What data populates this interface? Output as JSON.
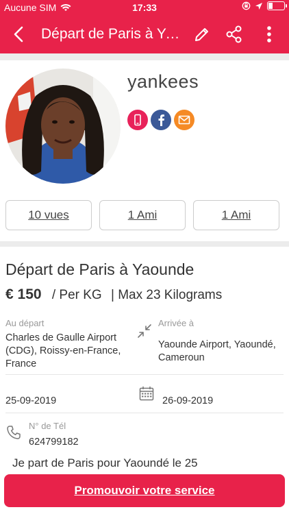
{
  "status_bar": {
    "carrier": "Aucune SIM",
    "time": "17:33"
  },
  "app_bar": {
    "title": "Départ de Paris à Yaounde"
  },
  "profile": {
    "username": "yankees",
    "social_icons": [
      "phone-icon",
      "facebook-icon",
      "email-icon"
    ],
    "social_colors": {
      "phone": "#e8225a",
      "facebook": "#3b5998",
      "email": "#f58a25"
    },
    "stats": [
      "10 vues",
      "1 Ami",
      "1 Ami"
    ]
  },
  "trip": {
    "title": "Départ de Paris à Yaounde",
    "price": "€ 150",
    "unit": "/ Per KG",
    "max": "| Max 23 Kilograms",
    "departure_label": "Au départ",
    "departure_value": "Charles de Gaulle Airport (CDG), Roissy-en-France, France",
    "arrival_label": "Arrivée à",
    "arrival_value": "Yaounde Airport, Yaoundé, Cameroun",
    "date_from": "25-09-2019",
    "date_to": "26-09-2019",
    "phone_label": "N° de Tél",
    "phone_value": "624799182",
    "description": "Je part de Paris pour Yaoundé le 25"
  },
  "promo_button": "Promouvoir votre service",
  "colors": {
    "accent": "#e8224a"
  }
}
